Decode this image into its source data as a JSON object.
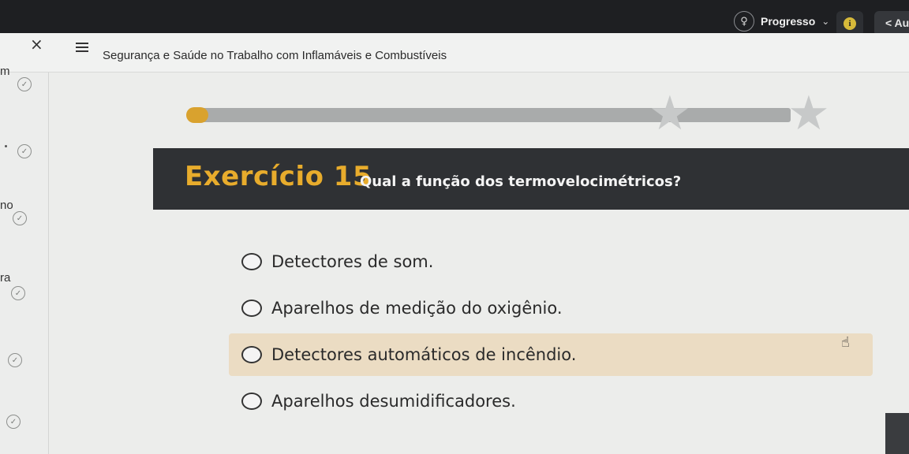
{
  "topbar": {
    "progress_label": "Progresso",
    "au_label": "< Au",
    "info_icon": "info-icon",
    "trophy_icon": "trophy-icon"
  },
  "course": {
    "title": "Segurança e Saúde no Trabalho com Inflamáveis e Combustíveis"
  },
  "sidebar": {
    "fragments": [
      "m",
      "no",
      "ra"
    ]
  },
  "exercise": {
    "title": "Exercício 15",
    "question": "Qual a função dos termovelocimétricos?"
  },
  "options": [
    {
      "label": "Detectores de som.",
      "selected": false
    },
    {
      "label": "Aparelhos de medição do oxigênio.",
      "selected": false
    },
    {
      "label": "Detectores automáticos de incêndio.",
      "selected": true
    },
    {
      "label": "Aparelhos desumidificadores.",
      "selected": false
    }
  ],
  "colors": {
    "accent": "#e8ac2c",
    "band": "#2f3134",
    "selected_bg": "#ebdcc3"
  }
}
